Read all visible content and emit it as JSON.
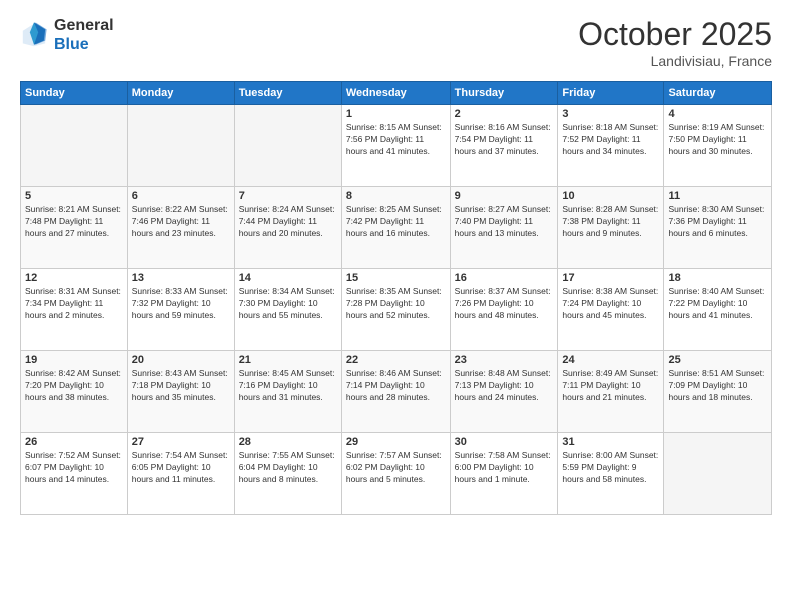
{
  "header": {
    "logo_general": "General",
    "logo_blue": "Blue",
    "month": "October 2025",
    "location": "Landivisiau, France"
  },
  "days_of_week": [
    "Sunday",
    "Monday",
    "Tuesday",
    "Wednesday",
    "Thursday",
    "Friday",
    "Saturday"
  ],
  "weeks": [
    [
      {
        "day": "",
        "info": ""
      },
      {
        "day": "",
        "info": ""
      },
      {
        "day": "",
        "info": ""
      },
      {
        "day": "1",
        "info": "Sunrise: 8:15 AM\nSunset: 7:56 PM\nDaylight: 11 hours and 41 minutes."
      },
      {
        "day": "2",
        "info": "Sunrise: 8:16 AM\nSunset: 7:54 PM\nDaylight: 11 hours and 37 minutes."
      },
      {
        "day": "3",
        "info": "Sunrise: 8:18 AM\nSunset: 7:52 PM\nDaylight: 11 hours and 34 minutes."
      },
      {
        "day": "4",
        "info": "Sunrise: 8:19 AM\nSunset: 7:50 PM\nDaylight: 11 hours and 30 minutes."
      }
    ],
    [
      {
        "day": "5",
        "info": "Sunrise: 8:21 AM\nSunset: 7:48 PM\nDaylight: 11 hours and 27 minutes."
      },
      {
        "day": "6",
        "info": "Sunrise: 8:22 AM\nSunset: 7:46 PM\nDaylight: 11 hours and 23 minutes."
      },
      {
        "day": "7",
        "info": "Sunrise: 8:24 AM\nSunset: 7:44 PM\nDaylight: 11 hours and 20 minutes."
      },
      {
        "day": "8",
        "info": "Sunrise: 8:25 AM\nSunset: 7:42 PM\nDaylight: 11 hours and 16 minutes."
      },
      {
        "day": "9",
        "info": "Sunrise: 8:27 AM\nSunset: 7:40 PM\nDaylight: 11 hours and 13 minutes."
      },
      {
        "day": "10",
        "info": "Sunrise: 8:28 AM\nSunset: 7:38 PM\nDaylight: 11 hours and 9 minutes."
      },
      {
        "day": "11",
        "info": "Sunrise: 8:30 AM\nSunset: 7:36 PM\nDaylight: 11 hours and 6 minutes."
      }
    ],
    [
      {
        "day": "12",
        "info": "Sunrise: 8:31 AM\nSunset: 7:34 PM\nDaylight: 11 hours and 2 minutes."
      },
      {
        "day": "13",
        "info": "Sunrise: 8:33 AM\nSunset: 7:32 PM\nDaylight: 10 hours and 59 minutes."
      },
      {
        "day": "14",
        "info": "Sunrise: 8:34 AM\nSunset: 7:30 PM\nDaylight: 10 hours and 55 minutes."
      },
      {
        "day": "15",
        "info": "Sunrise: 8:35 AM\nSunset: 7:28 PM\nDaylight: 10 hours and 52 minutes."
      },
      {
        "day": "16",
        "info": "Sunrise: 8:37 AM\nSunset: 7:26 PM\nDaylight: 10 hours and 48 minutes."
      },
      {
        "day": "17",
        "info": "Sunrise: 8:38 AM\nSunset: 7:24 PM\nDaylight: 10 hours and 45 minutes."
      },
      {
        "day": "18",
        "info": "Sunrise: 8:40 AM\nSunset: 7:22 PM\nDaylight: 10 hours and 41 minutes."
      }
    ],
    [
      {
        "day": "19",
        "info": "Sunrise: 8:42 AM\nSunset: 7:20 PM\nDaylight: 10 hours and 38 minutes."
      },
      {
        "day": "20",
        "info": "Sunrise: 8:43 AM\nSunset: 7:18 PM\nDaylight: 10 hours and 35 minutes."
      },
      {
        "day": "21",
        "info": "Sunrise: 8:45 AM\nSunset: 7:16 PM\nDaylight: 10 hours and 31 minutes."
      },
      {
        "day": "22",
        "info": "Sunrise: 8:46 AM\nSunset: 7:14 PM\nDaylight: 10 hours and 28 minutes."
      },
      {
        "day": "23",
        "info": "Sunrise: 8:48 AM\nSunset: 7:13 PM\nDaylight: 10 hours and 24 minutes."
      },
      {
        "day": "24",
        "info": "Sunrise: 8:49 AM\nSunset: 7:11 PM\nDaylight: 10 hours and 21 minutes."
      },
      {
        "day": "25",
        "info": "Sunrise: 8:51 AM\nSunset: 7:09 PM\nDaylight: 10 hours and 18 minutes."
      }
    ],
    [
      {
        "day": "26",
        "info": "Sunrise: 7:52 AM\nSunset: 6:07 PM\nDaylight: 10 hours and 14 minutes."
      },
      {
        "day": "27",
        "info": "Sunrise: 7:54 AM\nSunset: 6:05 PM\nDaylight: 10 hours and 11 minutes."
      },
      {
        "day": "28",
        "info": "Sunrise: 7:55 AM\nSunset: 6:04 PM\nDaylight: 10 hours and 8 minutes."
      },
      {
        "day": "29",
        "info": "Sunrise: 7:57 AM\nSunset: 6:02 PM\nDaylight: 10 hours and 5 minutes."
      },
      {
        "day": "30",
        "info": "Sunrise: 7:58 AM\nSunset: 6:00 PM\nDaylight: 10 hours and 1 minute."
      },
      {
        "day": "31",
        "info": "Sunrise: 8:00 AM\nSunset: 5:59 PM\nDaylight: 9 hours and 58 minutes."
      },
      {
        "day": "",
        "info": ""
      }
    ]
  ]
}
